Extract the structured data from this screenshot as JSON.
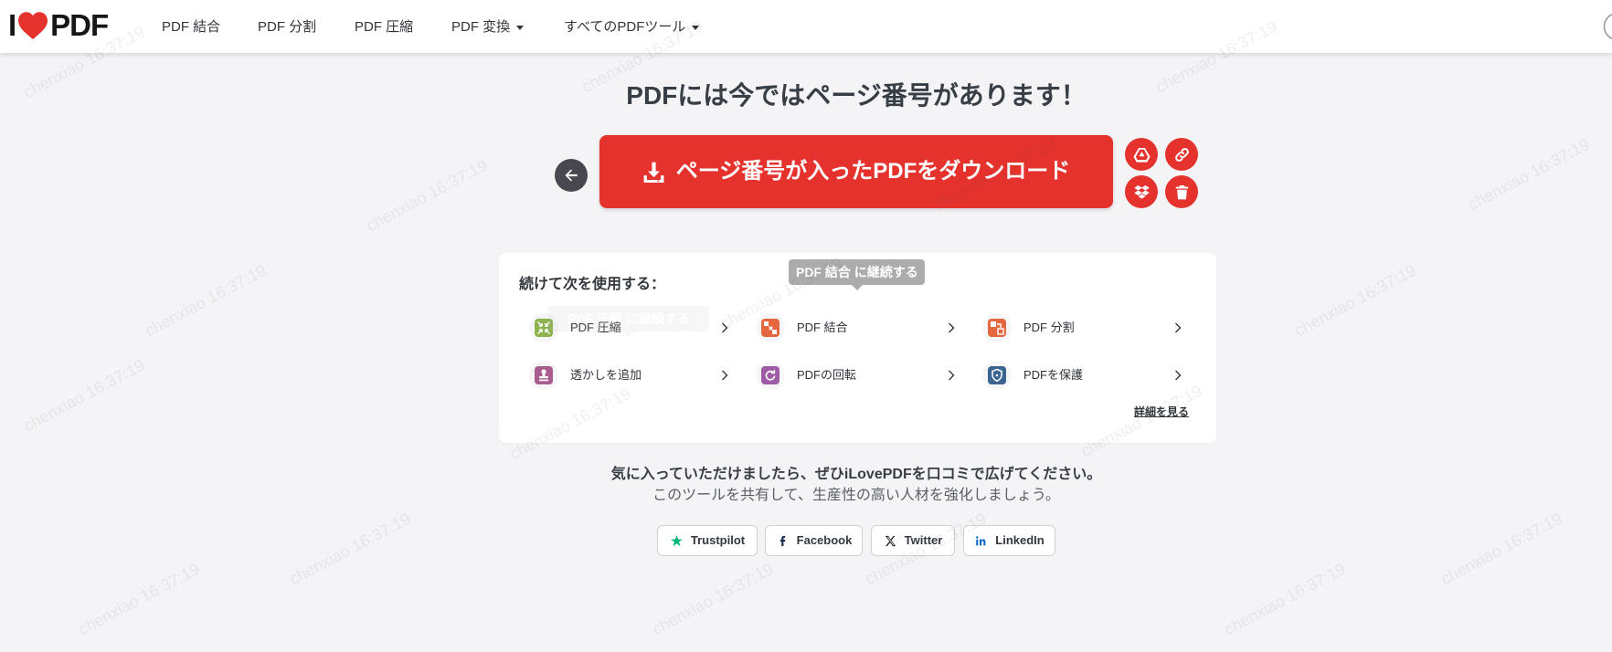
{
  "header": {
    "logo": {
      "left": "I",
      "right": "PDF",
      "icon": "heart-icon"
    },
    "nav": [
      {
        "label": "PDF 結合",
        "dropdown": false
      },
      {
        "label": "PDF 分割",
        "dropdown": false
      },
      {
        "label": "PDF 圧縮",
        "dropdown": false
      },
      {
        "label": "PDF 変換",
        "dropdown": true
      },
      {
        "label": "すべてのPDFツール",
        "dropdown": true
      }
    ],
    "menu_icon": "circle-menu-icon"
  },
  "result": {
    "title": "PDFには今ではページ番号があります！",
    "download_button": {
      "label": "ページ番号が入ったPDFをダウンロード",
      "icon": "download-icon"
    },
    "back_button": {
      "icon": "arrow-left-icon"
    },
    "actions": [
      {
        "icon": "google-drive-icon"
      },
      {
        "icon": "link-icon"
      },
      {
        "icon": "dropbox-icon"
      },
      {
        "icon": "trash-icon"
      }
    ]
  },
  "continue": {
    "heading": "続けて次を使用する：",
    "tooltip": "PDF 結合 に継続する",
    "fading_tooltip": "PDF 圧縮 に継続する",
    "tools": [
      {
        "label": "PDF 圧縮",
        "icon": "compress-icon",
        "color": "#8db24e"
      },
      {
        "label": "PDF 結合",
        "icon": "merge-icon",
        "color": "#e5673f"
      },
      {
        "label": "PDF 分割",
        "icon": "split-icon",
        "color": "#e5673f"
      },
      {
        "label": "透かしを追加",
        "icon": "stamp-icon",
        "color": "#a95c8e"
      },
      {
        "label": "PDFの回転",
        "icon": "rotate-icon",
        "color": "#a05ba7"
      },
      {
        "label": "PDFを保護",
        "icon": "shield-icon",
        "color": "#3b6492"
      }
    ],
    "more_link": "詳細を見る"
  },
  "share": {
    "headline": "気に入っていただけましたら、ぜひiLovePDFを口コミで広げてください。",
    "subline": "このツールを共有して、生産性の高い人材を強化しましょう。",
    "buttons": [
      {
        "label": "Trustpilot",
        "icon": "trustpilot-star-icon"
      },
      {
        "label": "Facebook",
        "icon": "facebook-icon"
      },
      {
        "label": "Twitter",
        "icon": "x-twitter-icon"
      },
      {
        "label": "LinkedIn",
        "icon": "linkedin-icon"
      }
    ]
  },
  "watermark": {
    "text": "chenxiao 16:37:19"
  },
  "colors": {
    "brand_red": "#e5322d",
    "back_button": "#47474f",
    "background": "#f4f4f6",
    "tooltip": "#acacac"
  }
}
